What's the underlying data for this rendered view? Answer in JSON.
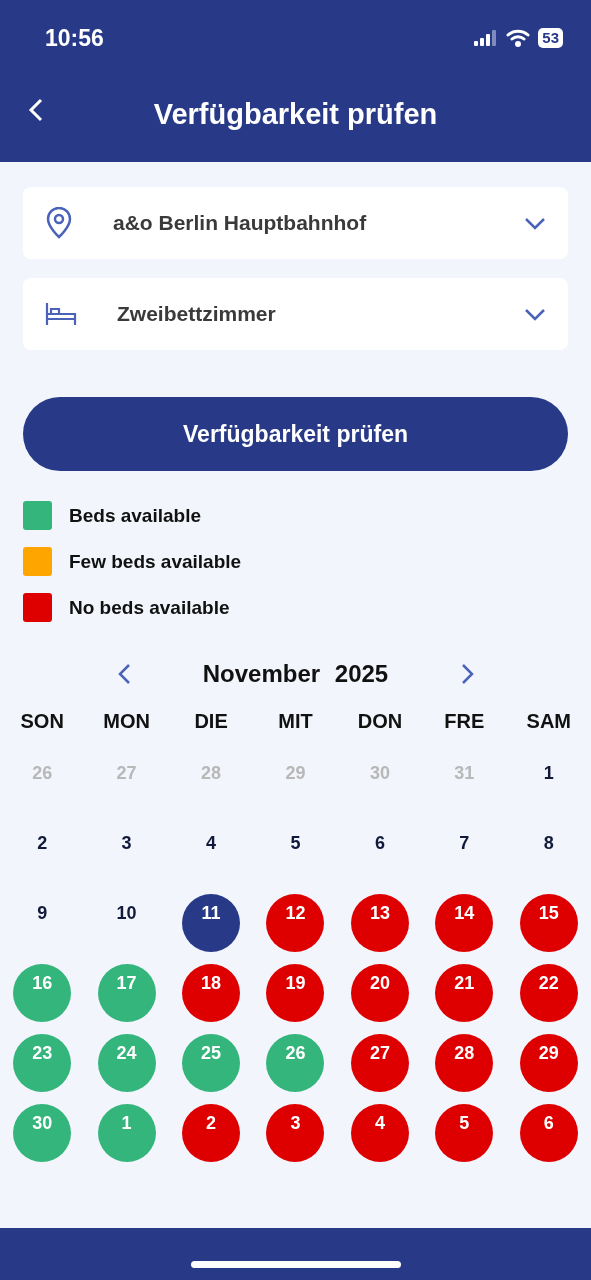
{
  "status_bar": {
    "time": "10:56",
    "battery": "53"
  },
  "header": {
    "title": "Verfügbarkeit prüfen"
  },
  "selects": [
    {
      "kind": "location",
      "value": "a&o Berlin Hauptbahnhof"
    },
    {
      "kind": "room",
      "value": "Zweibettzimmer"
    }
  ],
  "check_button": "Verfügbarkeit prüfen",
  "legend": [
    {
      "label": "Beds available",
      "color": "#33b57b"
    },
    {
      "label": "Few beds available",
      "color": "#ffa500"
    },
    {
      "label": "No beds available",
      "color": "#de0000"
    }
  ],
  "calendar": {
    "month": "November",
    "year": "2025",
    "weekdays": [
      "SON",
      "MON",
      "DIE",
      "MIT",
      "DON",
      "FRE",
      "SAM"
    ],
    "days": [
      {
        "label": "26",
        "kind": "outside"
      },
      {
        "label": "27",
        "kind": "outside"
      },
      {
        "label": "28",
        "kind": "outside"
      },
      {
        "label": "29",
        "kind": "outside"
      },
      {
        "label": "30",
        "kind": "outside"
      },
      {
        "label": "31",
        "kind": "outside"
      },
      {
        "label": "1",
        "kind": "plain"
      },
      {
        "label": "2",
        "kind": "plain"
      },
      {
        "label": "3",
        "kind": "plain"
      },
      {
        "label": "4",
        "kind": "plain"
      },
      {
        "label": "5",
        "kind": "plain"
      },
      {
        "label": "6",
        "kind": "plain"
      },
      {
        "label": "7",
        "kind": "plain"
      },
      {
        "label": "8",
        "kind": "plain"
      },
      {
        "label": "9",
        "kind": "plain"
      },
      {
        "label": "10",
        "kind": "plain"
      },
      {
        "label": "11",
        "kind": "today"
      },
      {
        "label": "12",
        "kind": "full"
      },
      {
        "label": "13",
        "kind": "full"
      },
      {
        "label": "14",
        "kind": "full"
      },
      {
        "label": "15",
        "kind": "full"
      },
      {
        "label": "16",
        "kind": "available"
      },
      {
        "label": "17",
        "kind": "available"
      },
      {
        "label": "18",
        "kind": "full"
      },
      {
        "label": "19",
        "kind": "full"
      },
      {
        "label": "20",
        "kind": "full"
      },
      {
        "label": "21",
        "kind": "full"
      },
      {
        "label": "22",
        "kind": "full"
      },
      {
        "label": "23",
        "kind": "available"
      },
      {
        "label": "24",
        "kind": "available"
      },
      {
        "label": "25",
        "kind": "available"
      },
      {
        "label": "26",
        "kind": "available"
      },
      {
        "label": "27",
        "kind": "full"
      },
      {
        "label": "28",
        "kind": "full"
      },
      {
        "label": "29",
        "kind": "full"
      },
      {
        "label": "30",
        "kind": "available"
      },
      {
        "label": "1",
        "kind": "available"
      },
      {
        "label": "2",
        "kind": "full"
      },
      {
        "label": "3",
        "kind": "full"
      },
      {
        "label": "4",
        "kind": "full"
      },
      {
        "label": "5",
        "kind": "full"
      },
      {
        "label": "6",
        "kind": "full"
      }
    ]
  }
}
